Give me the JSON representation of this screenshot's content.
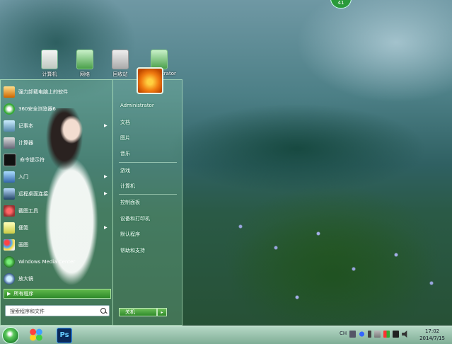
{
  "notification": {
    "count": "41"
  },
  "desktop_icons": [
    {
      "label": "计算机"
    },
    {
      "label": "网络"
    },
    {
      "label": "回收站"
    },
    {
      "label": "Administrator"
    }
  ],
  "start_menu": {
    "programs": [
      {
        "label": "强力卸载电脑上的软件",
        "icon": "uninstall-icon"
      },
      {
        "label": "360安全浏览器6",
        "icon": "browser-icon"
      },
      {
        "label": "记事本",
        "icon": "notepad-icon"
      },
      {
        "label": "计算器",
        "icon": "calculator-icon"
      },
      {
        "label": "命令提示符",
        "icon": "cmd-icon"
      },
      {
        "label": "入门",
        "icon": "getting-started-icon"
      },
      {
        "label": "远程桌面连接",
        "icon": "remote-desktop-icon"
      },
      {
        "label": "截图工具",
        "icon": "snipping-icon"
      },
      {
        "label": "便笺",
        "icon": "sticky-notes-icon"
      },
      {
        "label": "画图",
        "icon": "paint-icon"
      },
      {
        "label": "Windows Media Center",
        "icon": "media-center-icon"
      },
      {
        "label": "放大镜",
        "icon": "magnifier-icon"
      }
    ],
    "all_programs": "所有程序",
    "search_placeholder": "搜索程序和文件",
    "right_items": [
      {
        "label": "Administrator"
      },
      {
        "label": "文档"
      },
      {
        "label": "图片"
      },
      {
        "label": "音乐"
      },
      {
        "label": "游戏"
      },
      {
        "label": "计算机"
      },
      {
        "label": "控制面板"
      },
      {
        "label": "设备和打印机"
      },
      {
        "label": "默认程序"
      },
      {
        "label": "帮助和支持"
      }
    ],
    "shutdown": "关机"
  },
  "taskbar": {
    "clock_time": "17:02",
    "clock_date": "2014/7/15",
    "tray_text": "CH"
  }
}
